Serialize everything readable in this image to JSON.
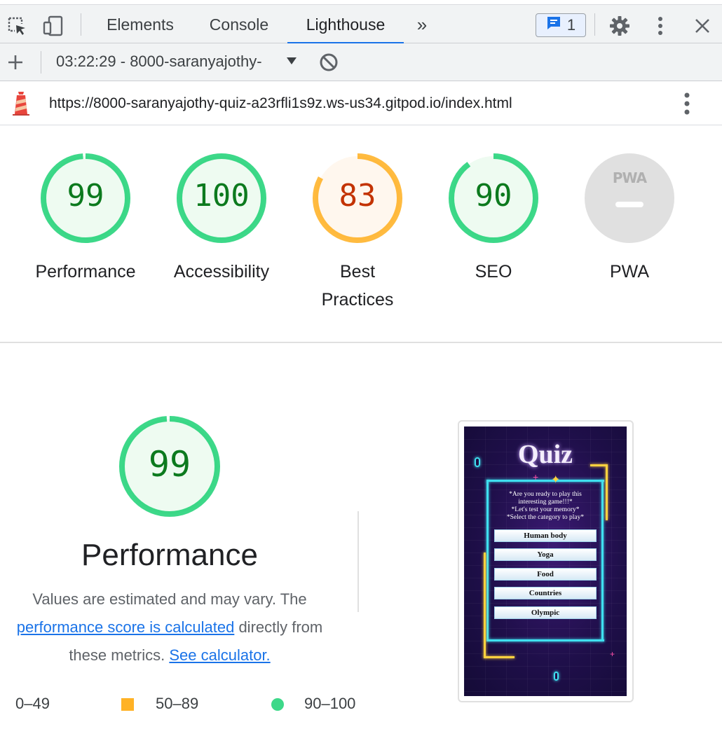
{
  "devtools": {
    "tabs": [
      {
        "label": "Elements"
      },
      {
        "label": "Console"
      },
      {
        "label": "Lighthouse"
      }
    ],
    "more_tabs": "»",
    "issues_count": "1",
    "report_select": "03:22:29 - 8000-saranyajothy-",
    "url": "https://8000-saranyajothy-quiz-a23rfli1s9z.ws-us34.gitpod.io/index.html"
  },
  "scores": [
    {
      "label": "Performance",
      "value": "99",
      "fraction": 0.99
    },
    {
      "label": "Accessibility",
      "value": "100",
      "fraction": 1.0
    },
    {
      "label": "Best Practices",
      "value": "83",
      "fraction": 0.83
    },
    {
      "label": "SEO",
      "value": "90",
      "fraction": 0.9
    },
    {
      "label": "PWA",
      "value": "",
      "badge_text": "PWA"
    }
  ],
  "performance": {
    "score": "99",
    "fraction": 0.99,
    "title": "Performance",
    "desc_1": "Values are estimated and may vary. The",
    "link_1": "performance score is calculated",
    "desc_2": " directly from",
    "desc_3": "these metrics. ",
    "link_2": "See calculator.",
    "legend": [
      {
        "range": "0–49"
      },
      {
        "range": "50–89"
      },
      {
        "range": "90–100"
      }
    ]
  },
  "screenshot": {
    "title": "Quiz",
    "intro": [
      "*Are you ready to play this",
      "interesting game!!!*",
      "*Let's test your memory*",
      "*Select the category to play*"
    ],
    "categories": [
      "Human body",
      "Yoga",
      "Food",
      "Countries",
      "Olympic"
    ]
  },
  "colors": {
    "pass": "#0cce6b",
    "pass_text": "#0c7a1e",
    "average": "#ffa400",
    "average_text": "#c33300",
    "pass_bg": "#eefbf1",
    "average_bg": "#fff7ee",
    "accent": "#1a73e8"
  }
}
